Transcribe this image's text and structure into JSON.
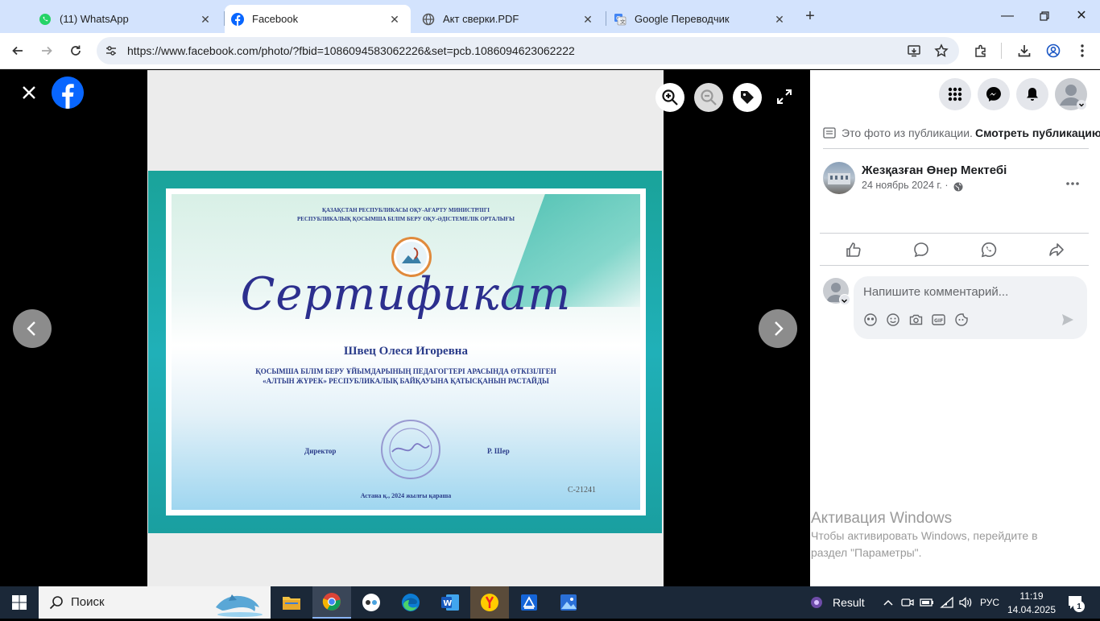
{
  "browser": {
    "tabs": [
      {
        "title": "(11) WhatsApp",
        "favicon": "whatsapp-icon"
      },
      {
        "title": "Facebook",
        "favicon": "facebook-icon",
        "active": true
      },
      {
        "title": "Акт сверки.PDF",
        "favicon": "globe-icon"
      },
      {
        "title": "Google Переводчик",
        "favicon": "google-translate-icon"
      }
    ],
    "url": "https://www.facebook.com/photo/?fbid=1086094583062226&set=pcb.1086094623062222"
  },
  "certificate": {
    "ministry_line1": "ҚАЗАҚСТАН РЕСПУБЛИКАСЫ ОҚУ-АҒАРТУ МИНИСТРЛІГІ",
    "ministry_line2": "РЕСПУБЛИКАЛЫҚ ҚОСЫМША БІЛІМ БЕРУ ОҚУ-ӘДІСТЕМЕЛІК ОРТАЛЫҒЫ",
    "title": "Сертификат",
    "recipient": "Швец Олеся Игоревна",
    "body_line1": "ҚОСЫМША БІЛІМ БЕРУ ҰЙЫМДАРЫНЫҢ ПЕДАГОГТЕРІ АРАСЫНДА ӨТКІЗІЛГЕН",
    "body_line2": "«АЛТЫН ЖҮРЕК» РЕСПУБЛИКАЛЫҚ БАЙҚАУЫНА ҚАТЫСҚАНЫН РАСТАЙДЫ",
    "director_label": "Директор",
    "director_name": "Р. Шер",
    "number": "С-21241",
    "place_date": "Астана қ., 2024 жылғы қараша"
  },
  "panel": {
    "from_post_text": "Это фото из публикации.",
    "view_post_label": "Смотреть публикацию",
    "author": "Жезқазған Өнер Мектебі",
    "date": "24 ноябрь 2024 г. ·",
    "comment_placeholder": "Напишите комментарий..."
  },
  "watermark": {
    "title": "Активация Windows",
    "line1": "Чтобы активировать Windows, перейдите в",
    "line2": "раздел \"Параметры\"."
  },
  "taskbar": {
    "search_placeholder": "Поиск",
    "weather_label": "Result",
    "language": "РУС",
    "time": "11:19",
    "date": "14.04.2025",
    "notification_count": "1"
  },
  "colors": {
    "facebook_blue": "#0866ff",
    "tabstrip": "#d3e3fd",
    "taskbar": "#1b2838"
  }
}
